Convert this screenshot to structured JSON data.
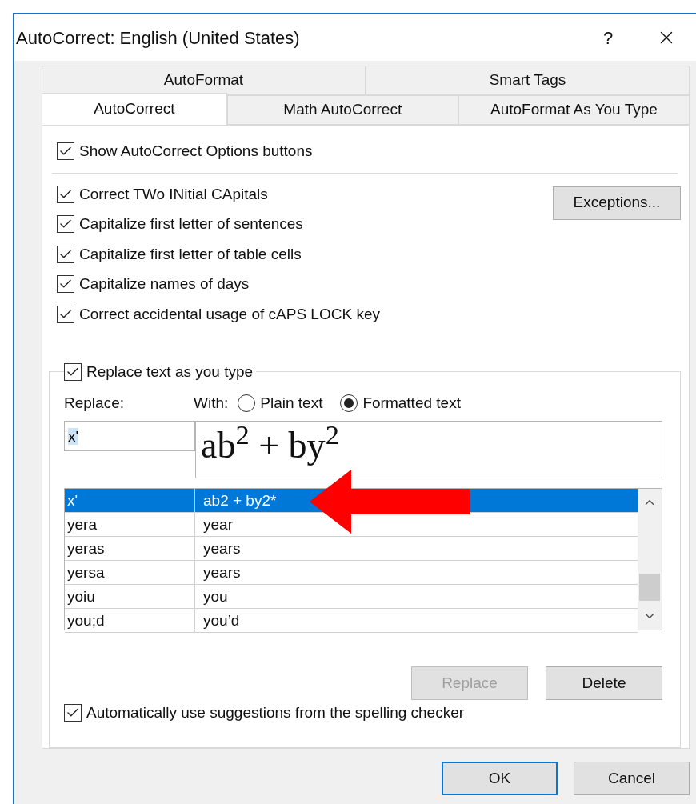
{
  "window": {
    "title": "AutoCorrect: English (United States)",
    "help": "?"
  },
  "tab_rows": [
    {
      "tabs": [
        {
          "label": "AutoFormat",
          "selected": false
        },
        {
          "label": "Smart Tags",
          "selected": false
        }
      ]
    },
    {
      "tabs": [
        {
          "label": "AutoCorrect",
          "selected": true
        },
        {
          "label": "Math AutoCorrect",
          "selected": false
        },
        {
          "label": "AutoFormat As You Type",
          "selected": false
        }
      ]
    }
  ],
  "show_options": {
    "label": "Show AutoCorrect Options buttons",
    "checked": true
  },
  "options": [
    {
      "label": "Correct TWo INitial CApitals",
      "checked": true
    },
    {
      "label": "Capitalize first letter of sentences",
      "checked": true
    },
    {
      "label": "Capitalize first letter of table cells",
      "checked": true
    },
    {
      "label": "Capitalize names of days",
      "checked": true
    },
    {
      "label": "Correct accidental usage of cAPS LOCK key",
      "checked": true
    }
  ],
  "exceptions_button": "Exceptions...",
  "replace_group": {
    "checkbox": {
      "label": "Replace text as you type",
      "checked": true
    },
    "replace_label": "Replace:",
    "with_label": "With:",
    "radios": [
      {
        "label": "Plain text",
        "selected": false
      },
      {
        "label": "Formatted text",
        "selected": true
      }
    ],
    "replace_value": "x'",
    "replace_value_selected": true,
    "with_value": "ab$^{2}$ + by$^{2}$",
    "rows": [
      {
        "replace": "x'",
        "with": "ab2 + by2*",
        "selected": true
      },
      {
        "replace": "yera",
        "with": "year",
        "selected": false
      },
      {
        "replace": "yeras",
        "with": "years",
        "selected": false
      },
      {
        "replace": "yersa",
        "with": "years",
        "selected": false
      },
      {
        "replace": "yoiu",
        "with": "you",
        "selected": false
      },
      {
        "replace": "you;d",
        "with": "you’d",
        "selected": false
      }
    ],
    "buttons": [
      {
        "label": "Replace",
        "disabled": true
      },
      {
        "label": "Delete",
        "disabled": false
      }
    ],
    "auto_suggest": {
      "label": "Automatically use suggestions from the spelling checker",
      "checked": true
    }
  },
  "footer_buttons": [
    {
      "label": "OK",
      "default": true
    },
    {
      "label": "Cancel",
      "default": false
    }
  ]
}
